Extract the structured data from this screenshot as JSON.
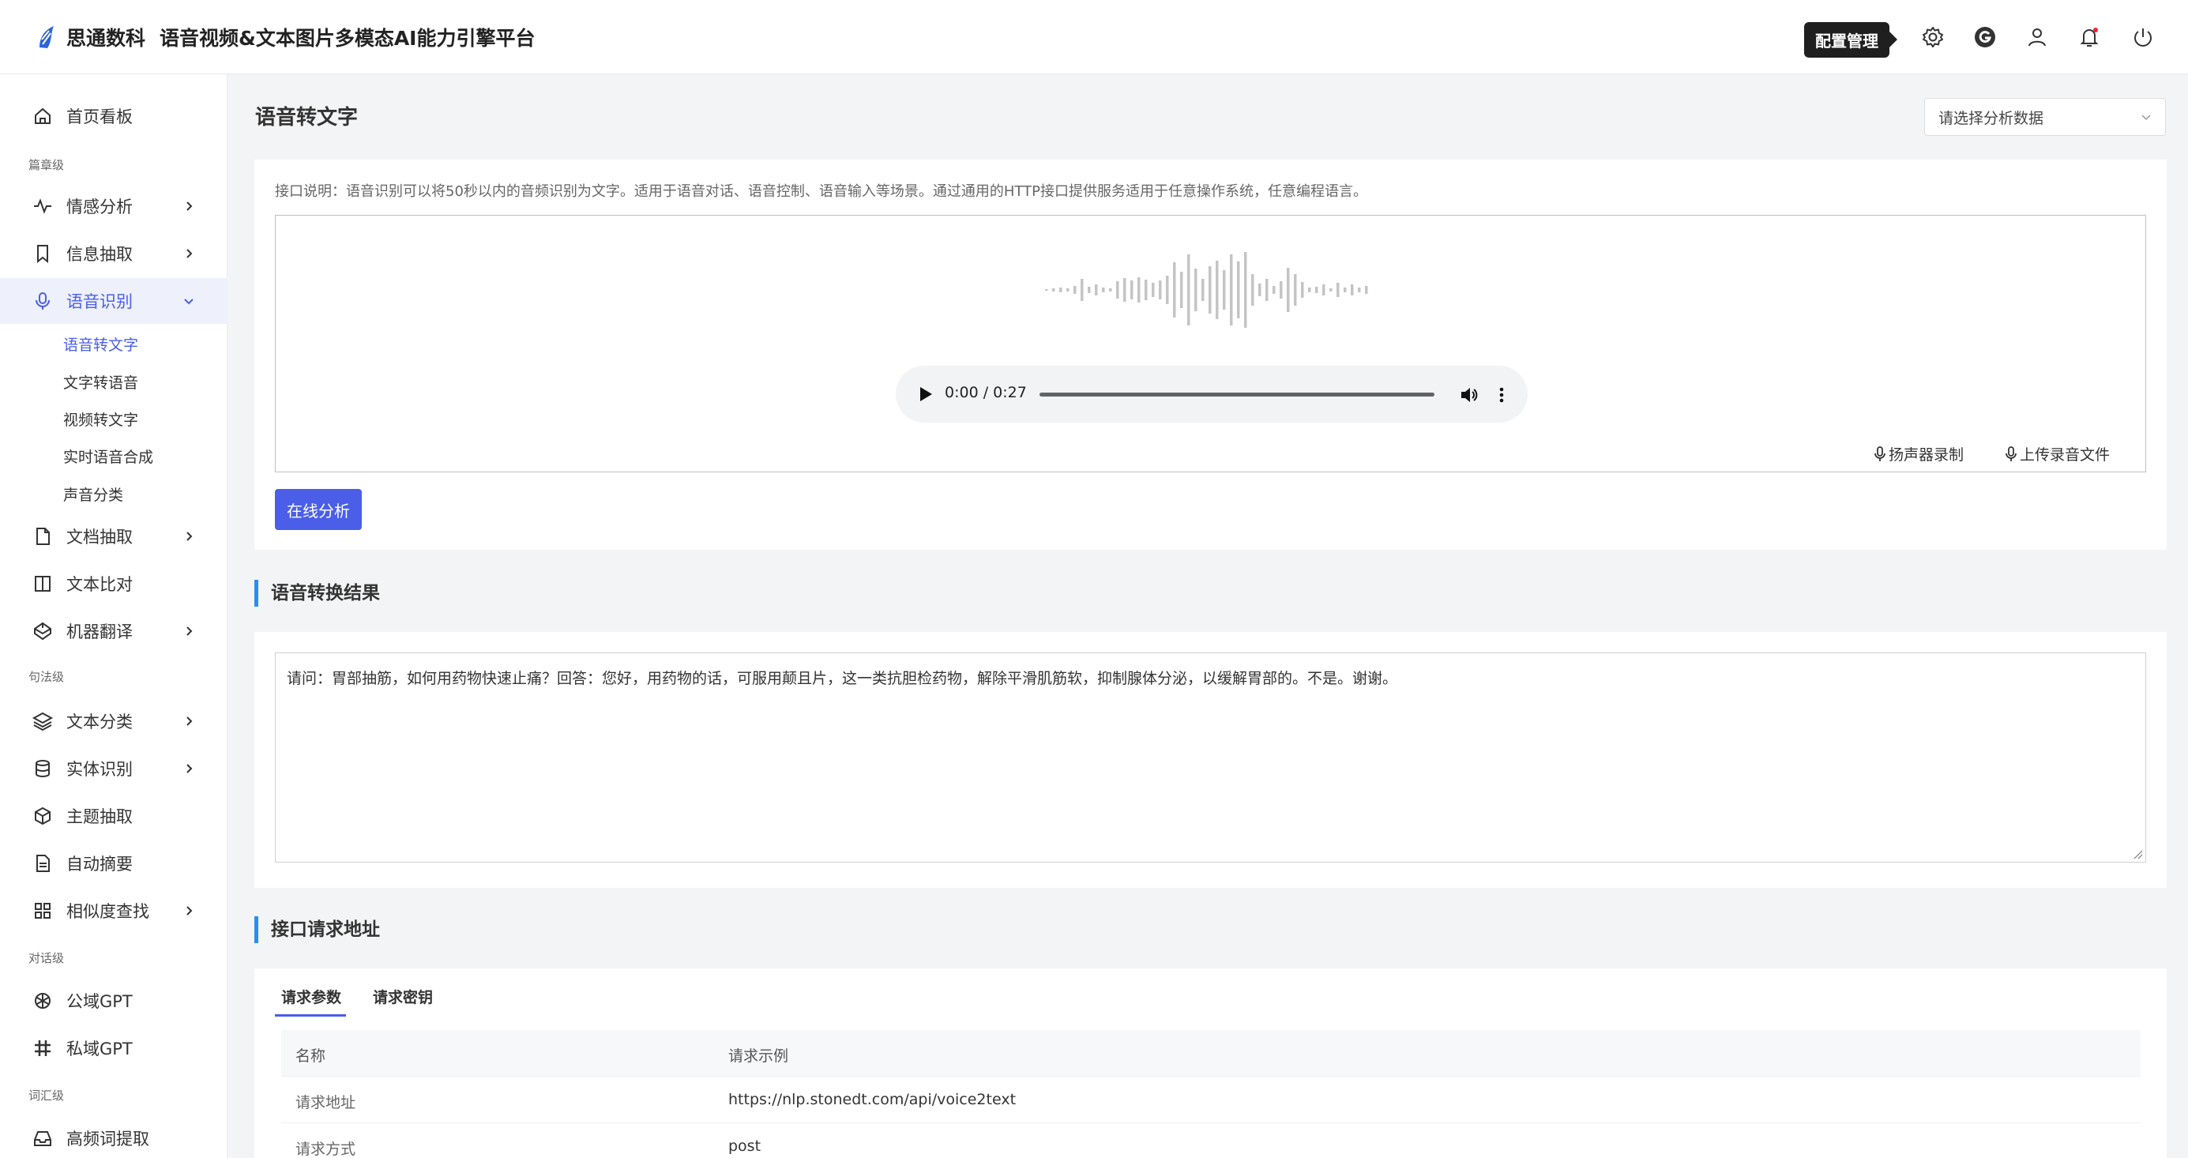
{
  "header": {
    "brand_name": "思通数科",
    "brand_sub": "语音视频&文本图片多模态AI能力引擎平台",
    "tooltip": "配置管理"
  },
  "sidebar": {
    "home": "首页看板",
    "group_article": "篇章级",
    "sentiment": "情感分析",
    "info_extract": "信息抽取",
    "speech": "语音识别",
    "speech_sub": [
      "语音转文字",
      "文字转语音",
      "视频转文字",
      "实时语音合成",
      "声音分类"
    ],
    "doc_extract": "文档抽取",
    "text_compare": "文本比对",
    "translate": "机器翻译",
    "group_sentence": "句法级",
    "text_classify": "文本分类",
    "entity": "实体识别",
    "topic": "主题抽取",
    "summary": "自动摘要",
    "similarity": "相似度查找",
    "group_dialog": "对话级",
    "public_gpt": "公域GPT",
    "private_gpt": "私域GPT",
    "group_word": "词汇级",
    "hot_words": "高频词提取"
  },
  "main": {
    "title": "语音转文字",
    "select_placeholder": "请选择分析数据",
    "description": "接口说明：语音识别可以将50秒以内的音频识别为文字。适用于语音对话、语音控制、语音输入等场景。通过通用的HTTP接口提供服务适用于任意操作系统，任意编程语言。",
    "player_time": "0:00 / 0:27",
    "record_speaker": "扬声器录制",
    "upload_audio": "上传录音文件",
    "analyze_button": "在线分析",
    "result_title": "语音转换结果",
    "result_text": "请问：胃部抽筋，如何用药物快速止痛？回答：您好，用药物的话，可服用颠且片，这一类抗胆检药物，解除平滑肌筋软，抑制腺体分泌，以缓解胃部的。不是。谢谢。",
    "api_title": "接口请求地址",
    "tabs": [
      "请求参数",
      "请求密钥"
    ],
    "table_headers": [
      "名称",
      "请求示例"
    ],
    "table_rows": [
      [
        "请求地址",
        "https://nlp.stonedt.com/api/voice2text"
      ],
      [
        "请求方式",
        "post"
      ]
    ]
  }
}
